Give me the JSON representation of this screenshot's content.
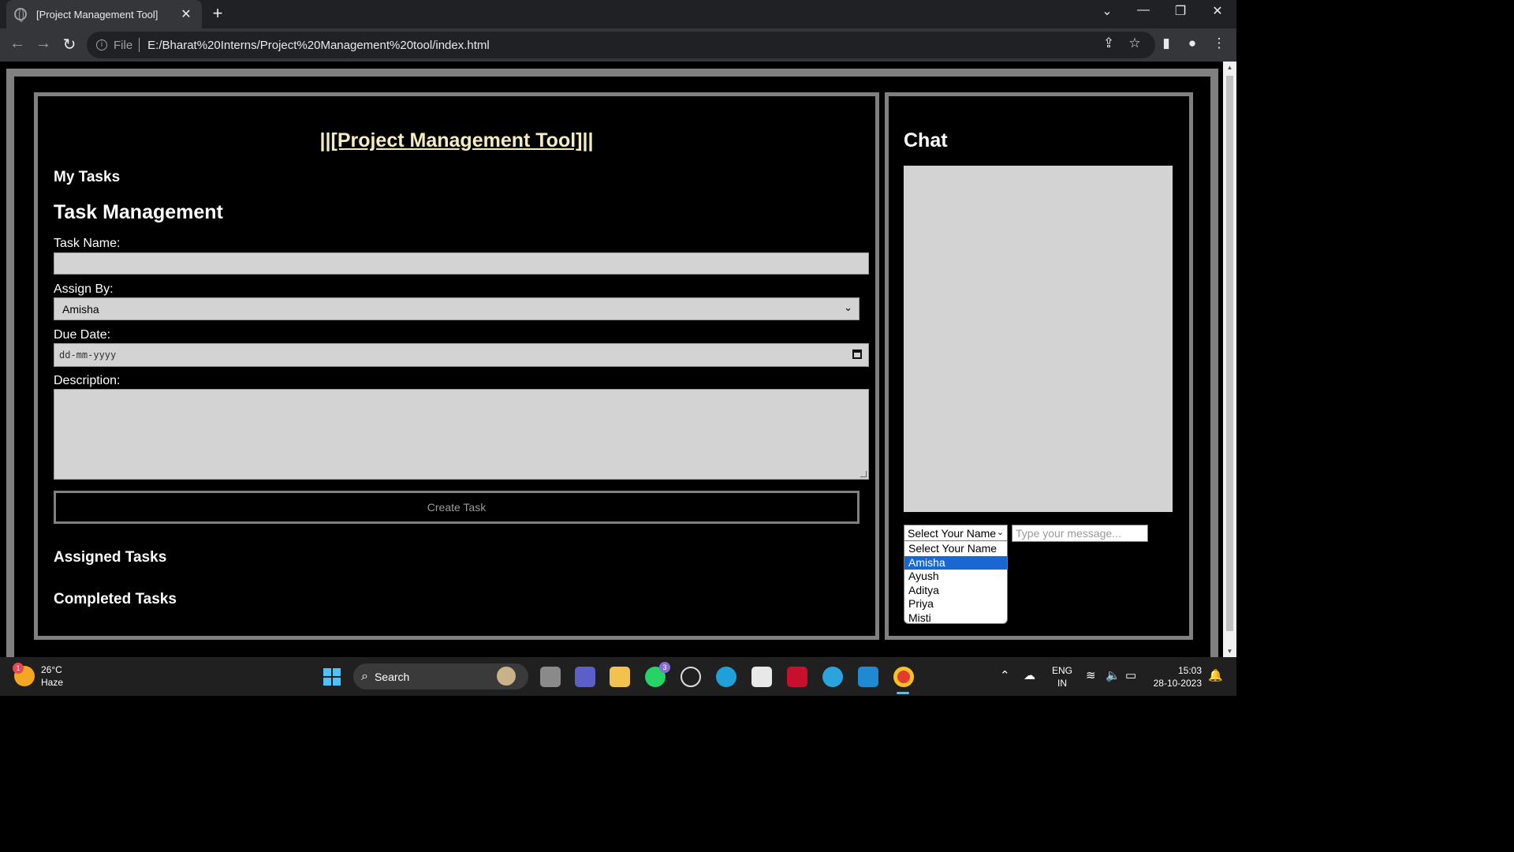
{
  "browser": {
    "tab_title": "[Project Management Tool]",
    "url_scheme": "File",
    "url": "E:/Bharat%20Interns/Project%20Management%20tool/index.html"
  },
  "page": {
    "app_title": "||[Project Management Tool]||",
    "my_tasks_heading": "My Tasks",
    "task_management_heading": "Task Management",
    "task_name_label": "Task Name:",
    "task_name_value": "",
    "assign_by_label": "Assign By:",
    "assign_by_value": "Amisha",
    "due_date_label": "Due Date:",
    "due_date_placeholder": "dd-mm-yyyy",
    "description_label": "Description:",
    "description_value": "",
    "create_button": "Create Task",
    "assigned_heading": "Assigned Tasks",
    "completed_heading": "Completed Tasks"
  },
  "chat": {
    "title": "Chat",
    "name_select_value": "Select Your Name",
    "message_placeholder": "Type your message...",
    "options": [
      "Select Your Name",
      "Amisha",
      "Ayush",
      "Aditya",
      "Priya",
      "Misti"
    ],
    "highlighted_option": "Amisha"
  },
  "taskbar": {
    "weather_badge": "1",
    "temperature": "26°C",
    "weather_condition": "Haze",
    "search_label": "Search",
    "whatsapp_badge": "3",
    "lang_primary": "ENG",
    "lang_region": "IN",
    "time": "15:03",
    "date": "28-10-2023"
  },
  "colors": {
    "title_color": "#f5ecc3",
    "panel_border": "#808080",
    "field_background": "#d3d3d3",
    "option_highlight": "#1967d2"
  }
}
